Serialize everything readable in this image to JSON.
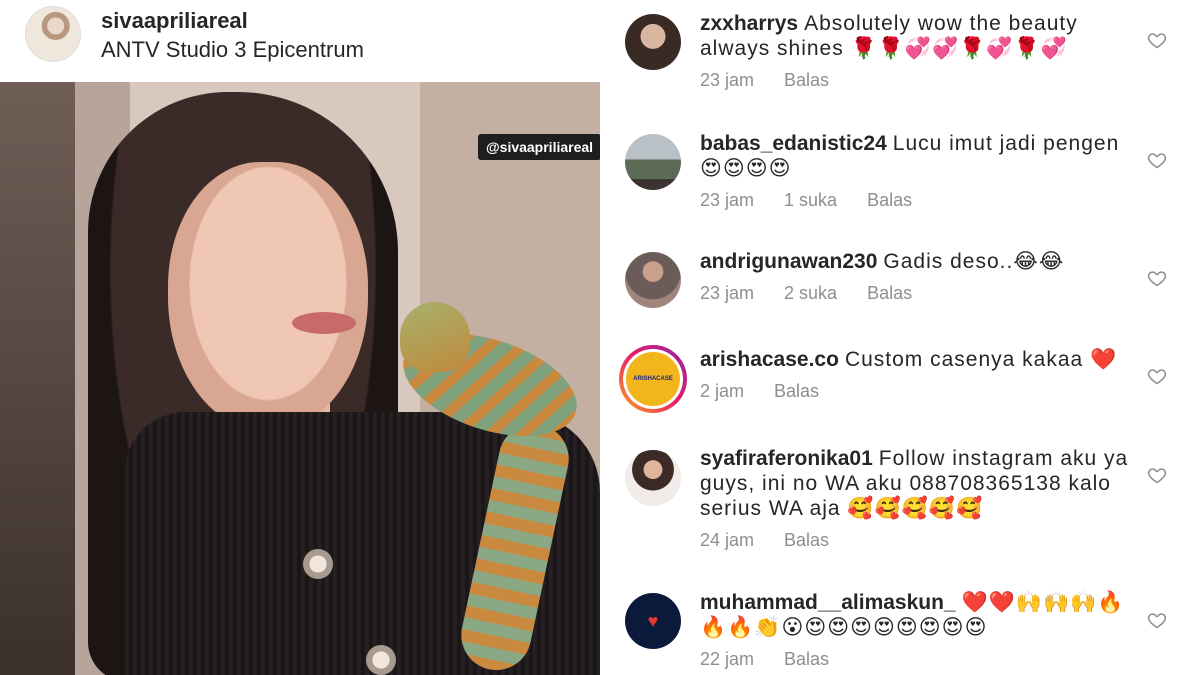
{
  "post": {
    "username": "sivaapriliareal",
    "location": "ANTV Studio 3 Epicentrum",
    "photo_tag": "@sivaapriliareal"
  },
  "comments": [
    {
      "user": "zxxharrys",
      "text": "Absolutely wow the beauty always shines 🌹🌹💞💞🌹💞🌹💞",
      "time": "23 jam",
      "likes": "",
      "reply": "Balas"
    },
    {
      "user": "babas_edanistic24",
      "text": "Lucu imut jadi pengen 😍😍😍😍",
      "time": "23 jam",
      "likes": "1 suka",
      "reply": "Balas"
    },
    {
      "user": "andrigunawan230",
      "text": "Gadis deso..😂😂",
      "time": "23 jam",
      "likes": "2 suka",
      "reply": "Balas"
    },
    {
      "user": "arishacase.co",
      "text": "Custom casenya kakaa ❤️",
      "time": "2 jam",
      "likes": "",
      "reply": "Balas",
      "avatar_text": "ARISHACASE"
    },
    {
      "user": "syafiraferonika01",
      "text": "Follow  instagram aku ya guys, ini no WA aku 088708365138 kalo serius WA aja 🥰🥰🥰🥰🥰",
      "time": "24 jam",
      "likes": "",
      "reply": "Balas"
    },
    {
      "user": "muhammad__alimaskun_",
      "text": "❤️❤️🙌🙌🙌🔥🔥🔥👏😮😍😍😍😍😍😍😍😍",
      "time": "22 jam",
      "likes": "",
      "reply": "Balas"
    }
  ],
  "icons": {
    "heart": "heart-outline-icon"
  },
  "colors": {
    "text": "#262626",
    "meta": "#8e8e8e",
    "story_ring_start": "#f9a825",
    "story_ring_end": "#c2185b"
  }
}
